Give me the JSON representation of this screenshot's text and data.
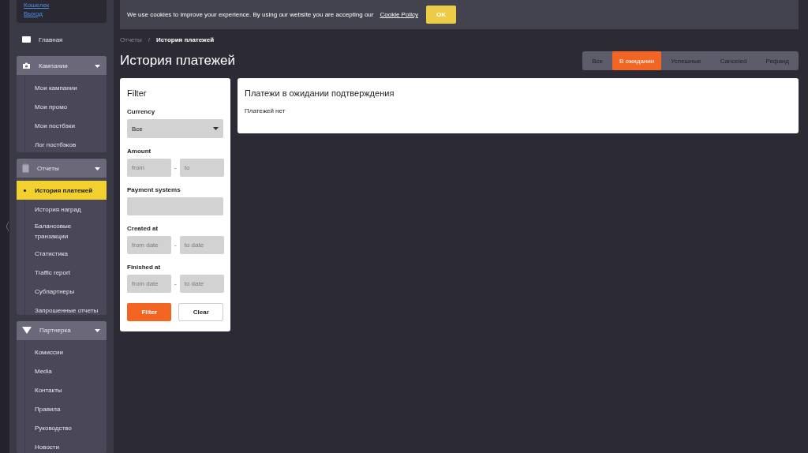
{
  "sidebar": {
    "account_links": [
      "Кошелек",
      "Выход"
    ],
    "home": {
      "label": "Главная"
    },
    "groups": [
      {
        "label": "Кампании",
        "expanded": true,
        "items": [
          {
            "label": "Мои кампании",
            "selected": false
          },
          {
            "label": "Мои промо",
            "selected": false
          },
          {
            "label": "Мои постбэки",
            "selected": false
          },
          {
            "label": "Лог постбэков",
            "selected": false
          }
        ]
      },
      {
        "label": "Отчеты",
        "expanded": true,
        "items": [
          {
            "label": "История платежей",
            "selected": true
          },
          {
            "label": "История наград",
            "selected": false
          },
          {
            "label": "Балансовые транзакции",
            "selected": false
          },
          {
            "label": "Статистика",
            "selected": false
          },
          {
            "label": "Traffic report",
            "selected": false
          },
          {
            "label": "Субпартнеры",
            "selected": false
          },
          {
            "label": "Запрошенные отчеты",
            "selected": false
          }
        ]
      },
      {
        "label": "Партнерка",
        "expanded": true,
        "items": [
          {
            "label": "Комиссии",
            "selected": false
          },
          {
            "label": "Media",
            "selected": false
          },
          {
            "label": "Контакты",
            "selected": false
          },
          {
            "label": "Правила",
            "selected": false
          },
          {
            "label": "Руководство",
            "selected": false
          },
          {
            "label": "Новости",
            "selected": false
          }
        ]
      }
    ],
    "collapse_handle": "〈"
  },
  "cookie_bar": {
    "text": "We use cookies to improve your experience. By using our website you are accepting our",
    "link": "Cookie Policy",
    "button": "OK"
  },
  "breadcrumb": [
    {
      "label": "Отчеты",
      "current": false
    },
    {
      "label": "История платежей",
      "current": true
    }
  ],
  "breadcrumb_separator": "/",
  "title": "История платежей",
  "tabs": [
    {
      "label": "Все",
      "selected": false
    },
    {
      "label": "В ожидании",
      "selected": true
    },
    {
      "label": "Успешные",
      "selected": false
    },
    {
      "label": "Canceled",
      "selected": false
    },
    {
      "label": "Рефанд",
      "selected": false
    }
  ],
  "filter": {
    "title": "Filter",
    "fields": [
      {
        "kind": "select",
        "label": "Currency",
        "value": "Все"
      },
      {
        "kind": "range",
        "label": "Amount",
        "from_placeholder": "from",
        "to_placeholder": "to",
        "separator": "-"
      },
      {
        "kind": "text",
        "label": "Payment systems"
      },
      {
        "kind": "range",
        "label": "Created at",
        "from_placeholder": "from date",
        "to_placeholder": "to date",
        "separator": "-"
      },
      {
        "kind": "range",
        "label": "Finished at",
        "from_placeholder": "from date",
        "to_placeholder": "to date",
        "separator": "-"
      }
    ],
    "submit": "Filter",
    "clear": "Clear"
  },
  "results": {
    "title": "Платежи в ожидании подтверждения",
    "empty_text": "Платежей нет"
  }
}
